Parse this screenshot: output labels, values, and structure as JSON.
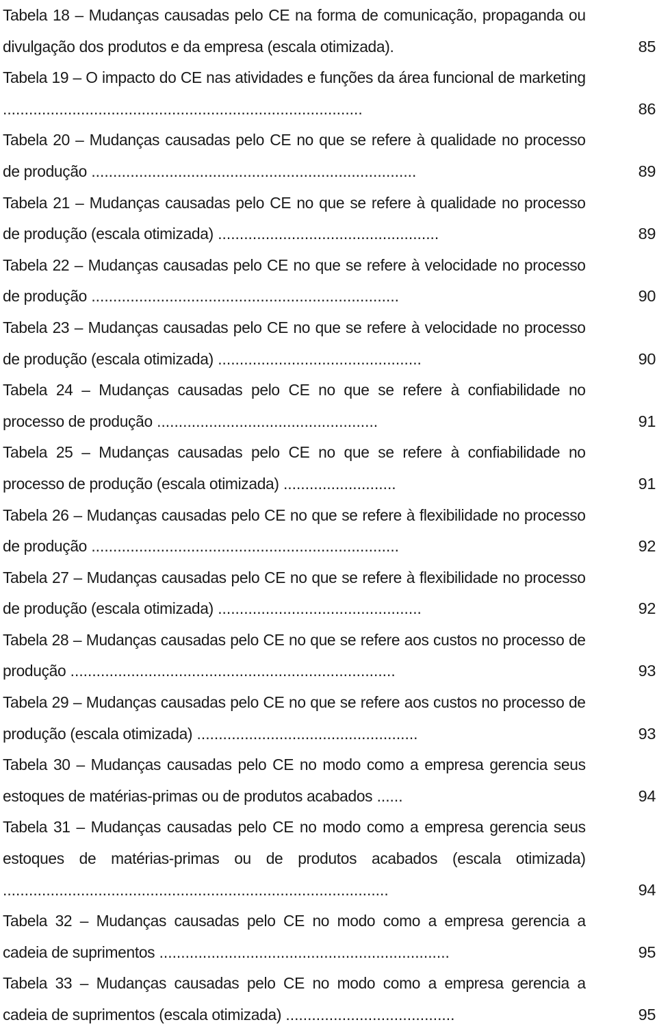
{
  "document": {
    "type": "list-of-tables",
    "entries": [
      {
        "label": "Tabela 18",
        "dash": "–",
        "title": "Mudanças causadas pelo CE na forma de comunicação, propaganda ou divulgação dos produtos e da empresa (escala otimizada).",
        "leader": "",
        "page": "85"
      },
      {
        "label": "Tabela 19",
        "dash": "–",
        "title": "O impacto do CE nas atividades e funções da área funcional de marketing",
        "leader": " ...................................................................................",
        "page": "86"
      },
      {
        "label": "Tabela 20",
        "dash": "–",
        "title": "Mudanças causadas pelo CE no que se refere à qualidade no processo de produção",
        "leader": " ...........................................................................",
        "page": "89"
      },
      {
        "label": "Tabela 21",
        "dash": "–",
        "title": "Mudanças causadas pelo CE no que se refere à qualidade no processo de produção (escala otimizada)",
        "leader": " ...................................................",
        "page": "89"
      },
      {
        "label": "Tabela 22",
        "dash": "–",
        "title": "Mudanças causadas pelo CE no que se refere à velocidade no processo de produção",
        "leader": " .......................................................................",
        "page": "90"
      },
      {
        "label": "Tabela 23",
        "dash": "–",
        "title": "Mudanças causadas pelo CE no que se refere à velocidade no processo de produção (escala otimizada)",
        "leader": " ...............................................",
        "page": "90"
      },
      {
        "label": "Tabela 24",
        "dash": "–",
        "title": "Mudanças causadas pelo CE no que se refere à confiabilidade no processo de produção",
        "leader": " ...................................................",
        "page": "91"
      },
      {
        "label": "Tabela 25",
        "dash": "–",
        "title": "Mudanças causadas pelo CE no que se refere à confiabilidade no processo de produção (escala otimizada)",
        "leader": " ..........................",
        "page": "91"
      },
      {
        "label": "Tabela 26",
        "dash": "–",
        "title": "Mudanças causadas pelo CE no que se refere à flexibilidade no processo de produção",
        "leader": " .......................................................................",
        "page": "92"
      },
      {
        "label": "Tabela 27",
        "dash": "–",
        "title": "Mudanças causadas pelo CE no que se refere à flexibilidade no processo de produção (escala otimizada)",
        "leader": " ...............................................",
        "page": "92"
      },
      {
        "label": "Tabela 28",
        "dash": "–",
        "title": "Mudanças causadas pelo CE no que se refere aos custos no processo de produção",
        "leader": " ...........................................................................",
        "page": "93"
      },
      {
        "label": "Tabela 29",
        "dash": "–",
        "title": "Mudanças causadas pelo CE no que se refere aos custos no processo de produção (escala otimizada)",
        "leader": " ...................................................",
        "page": "93"
      },
      {
        "label": "Tabela 30",
        "dash": "–",
        "title": "Mudanças causadas pelo CE no modo como a empresa gerencia seus estoques de matérias-primas ou de produtos acabados",
        "leader": " ......",
        "page": "94"
      },
      {
        "label": "Tabela 31",
        "dash": "–",
        "title": "Mudanças causadas pelo CE no modo como a empresa gerencia seus estoques de matérias-primas ou de produtos acabados (escala otimizada)",
        "leader": " .........................................................................................",
        "page": "94"
      },
      {
        "label": "Tabela 32",
        "dash": "–",
        "title": "Mudanças causadas pelo CE no modo como a empresa gerencia a cadeia de suprimentos",
        "leader": " ...................................................................",
        "page": "95"
      },
      {
        "label": "Tabela 33",
        "dash": "–",
        "title": "Mudanças causadas pelo CE no modo como a empresa gerencia a cadeia de suprimentos (escala otimizada)",
        "leader": " .......................................",
        "page": "95"
      }
    ]
  }
}
